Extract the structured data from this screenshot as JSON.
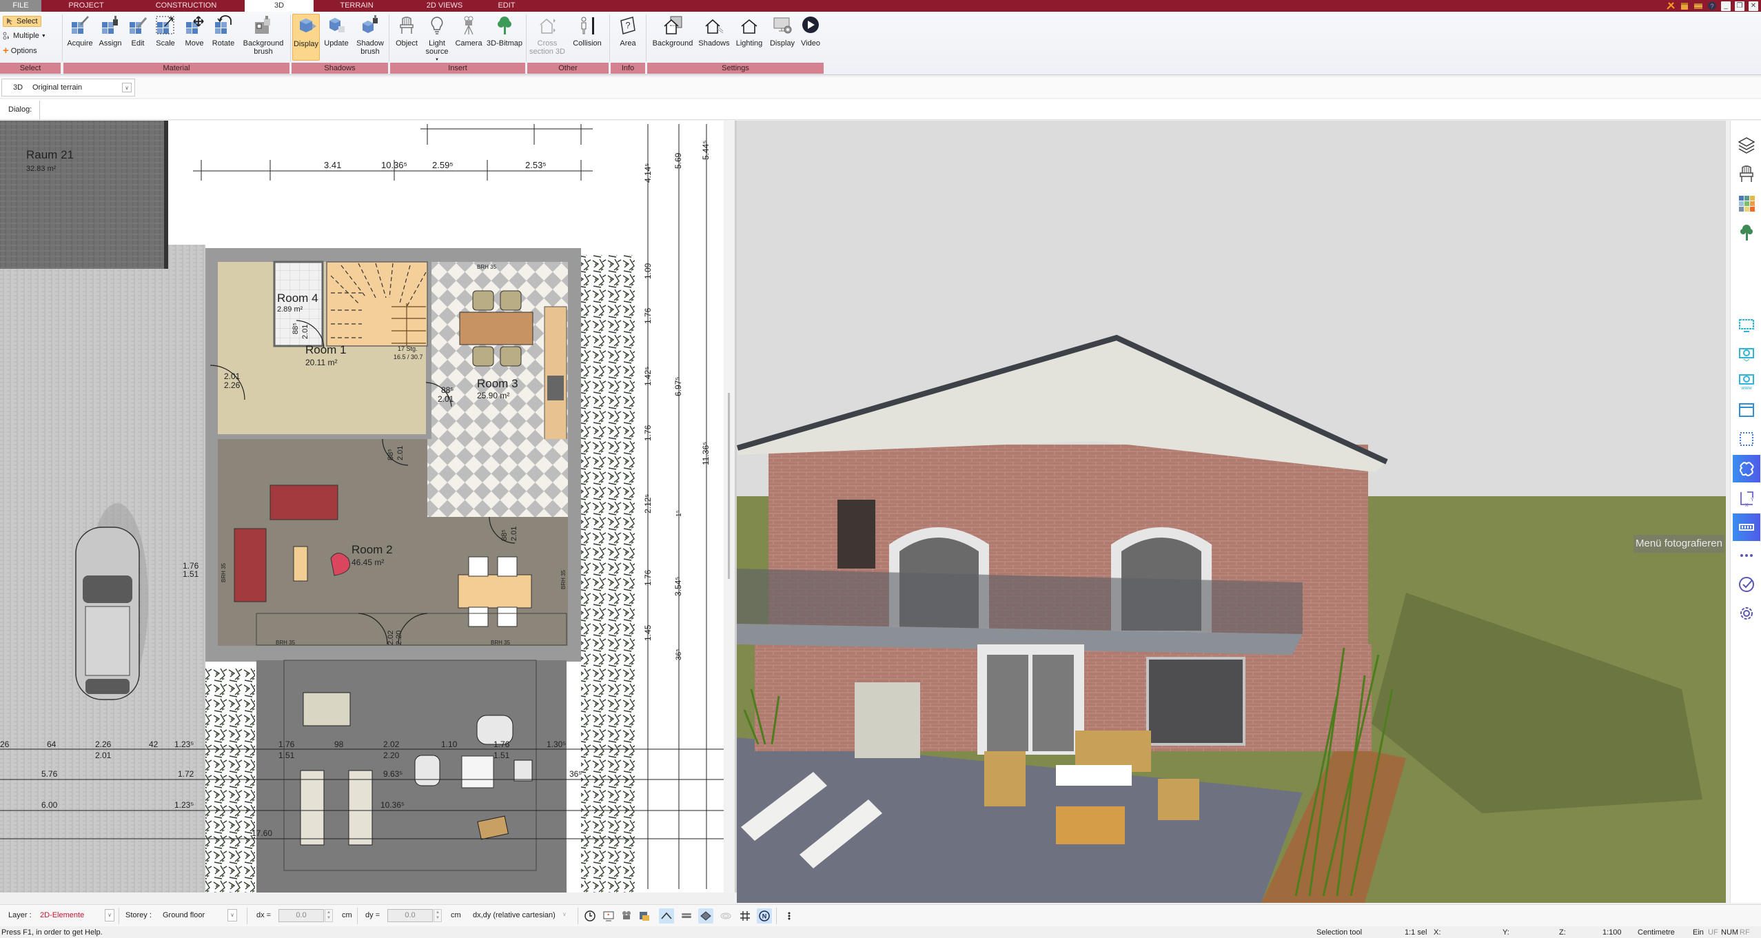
{
  "menu_tabs": [
    {
      "label": "FILE",
      "active": false
    },
    {
      "label": "PROJECT",
      "active": false
    },
    {
      "label": "CONSTRUCTION",
      "active": false
    },
    {
      "label": "3D",
      "active": true
    },
    {
      "label": "TERRAIN",
      "active": false
    },
    {
      "label": "2D VIEWS",
      "active": false
    },
    {
      "label": "EDIT",
      "active": false
    }
  ],
  "window_controls": {
    "tools_icon": "tools-icon",
    "minimize": "_",
    "restore": "❐",
    "close": "✕"
  },
  "ribbon": {
    "select_group": {
      "label": "Select",
      "select": "Select",
      "multiple": "Multiple",
      "options": "Options"
    },
    "material_group": {
      "label": "Material",
      "buttons": [
        "Acquire",
        "Assign",
        "Edit",
        "Scale",
        "Move",
        "Rotate",
        "Background brush"
      ]
    },
    "shadows_group": {
      "label": "Shadows",
      "buttons": [
        "Display",
        "Update",
        "Shadow brush"
      ],
      "active": "Display"
    },
    "insert_group": {
      "label": "Insert",
      "buttons": [
        "Object",
        "Light source",
        "Camera",
        "3D-Bitmap"
      ]
    },
    "other_group": {
      "label": "Other",
      "buttons": [
        "Cross section 3D",
        "Collision"
      ],
      "disabled": [
        "Cross section 3D"
      ]
    },
    "info_group": {
      "label": "Info",
      "buttons": [
        "Area"
      ]
    },
    "settings_group": {
      "label": "Settings",
      "buttons": [
        "Background",
        "Shadows",
        "Lighting",
        "Display",
        "Video"
      ]
    }
  },
  "view_selector": {
    "mode": "3D",
    "value": "Original terrain"
  },
  "dialog_bar": {
    "label": "Dialog:"
  },
  "floor_plan": {
    "rooms": [
      {
        "name": "Raum 21",
        "area": "32.83 m²"
      },
      {
        "name": "Room 4",
        "area": "2.89 m²"
      },
      {
        "name": "Room 1",
        "area": "20.11 m²"
      },
      {
        "name": "Room 3",
        "area": "25.90 m²"
      },
      {
        "name": "Room 2",
        "area": "46.45 m²"
      }
    ],
    "stair_label": "17 Stg.",
    "stair_dims": "16.5 / 30.7",
    "window_labels": [
      "BRH 35",
      "BRH 35",
      "BRH 35",
      "BRH 35",
      "BRH 35",
      "BRH 35"
    ],
    "top_dimensions": [
      "3.41",
      "10.36⁵",
      "2.59⁵",
      "2.53⁵"
    ],
    "right_dimensions_outer": [
      "4.14⁵",
      "1.09",
      "1.76",
      "1.42⁵",
      "1.76",
      "2.12⁵",
      "1.76",
      "1.45"
    ],
    "right_dimensions_middle": [
      "5.69",
      "6.97⁵",
      "1⁵",
      "3.54⁵",
      "36⁵"
    ],
    "right_dimensions_far": [
      "5.44⁵",
      "11.36⁵"
    ],
    "bottom_dimensions_row1": [
      "26",
      "64",
      "2.26",
      "42",
      "1.23⁵",
      "1.76",
      "98",
      "2.02",
      "1.10",
      "1.76",
      "1.30⁵"
    ],
    "bottom_dimensions_row1_sub": [
      "2.01",
      "1.51",
      "2.20",
      "1.51"
    ],
    "bottom_dimensions_row2": [
      "5.76",
      "1.72",
      "9.63⁵",
      "36⁵"
    ],
    "bottom_dimensions_row3": [
      "6.00",
      "1.23⁵",
      "10.36⁵"
    ],
    "bottom_dimensions_row4": [
      "17.60"
    ],
    "door_labels": [
      {
        "a": "88⁵",
        "b": "2.01"
      },
      {
        "a": "2.01",
        "b": "2.26"
      },
      {
        "a": "88⁵",
        "b": "2.01"
      },
      {
        "a": "88⁵",
        "b": "2.01"
      },
      {
        "a": "88⁵",
        "b": "2.01"
      },
      {
        "a": "2.02",
        "b": "2.20"
      }
    ],
    "window_dims": {
      "a": "1.76",
      "b": "1.51"
    }
  },
  "right_sidebar": {
    "items": [
      {
        "icon": "layers-icon"
      },
      {
        "icon": "chair-icon"
      },
      {
        "icon": "materials-palette-icon"
      },
      {
        "icon": "tree-icon"
      },
      {
        "icon": "monitor-icon"
      },
      {
        "icon": "camera-download-icon"
      },
      {
        "icon": "camera-www-icon"
      },
      {
        "icon": "window-icon"
      },
      {
        "icon": "dotted-selection-icon"
      },
      {
        "icon": "puzzle-icon",
        "highlighted": true
      },
      {
        "icon": "xy-coordinates-icon"
      },
      {
        "icon": "ruler-icon",
        "highlighted": true
      },
      {
        "icon": "more-icon"
      },
      {
        "icon": "check-circle-icon"
      },
      {
        "icon": "settings-gear-icon"
      }
    ],
    "tooltip": "Menü fotografieren"
  },
  "bottom_toolbar": {
    "layer_label": "Layer :",
    "layer_value": "2D-Elemente",
    "layer_color": "#c8102e",
    "storey_label": "Storey :",
    "storey_value": "Ground floor",
    "dx_label": "dx =",
    "dx_value": "0.0",
    "dx_unit": "cm",
    "dy_label": "dy =",
    "dy_value": "0.0",
    "dy_unit": "cm",
    "coord_mode": "dx,dy (relative cartesian)",
    "tools": [
      {
        "icon": "clock-icon",
        "on": false
      },
      {
        "icon": "presentation-icon",
        "on": false
      },
      {
        "icon": "video-camera-icon",
        "on": false
      },
      {
        "icon": "layers-color-icon",
        "on": false
      },
      {
        "icon": "roof-icon",
        "on": true
      },
      {
        "icon": "logs-icon",
        "on": false
      },
      {
        "icon": "plane-icon",
        "on": true
      },
      {
        "icon": "terrain-icon",
        "on": false
      },
      {
        "icon": "grid-icon",
        "on": false
      },
      {
        "icon": "north-icon",
        "on": true
      },
      {
        "icon": "more-vertical-icon",
        "on": false
      }
    ]
  },
  "status_bar": {
    "help": "Press F1, in order to get Help.",
    "tool": "Selection tool",
    "sel": "1:1 sel",
    "x": "X:",
    "y": "Y:",
    "z": "Z:",
    "scale": "1:100",
    "unit": "Centimetre",
    "ein": "Ein",
    "uf": "UF",
    "num": "NUM",
    "rf": "RF"
  }
}
